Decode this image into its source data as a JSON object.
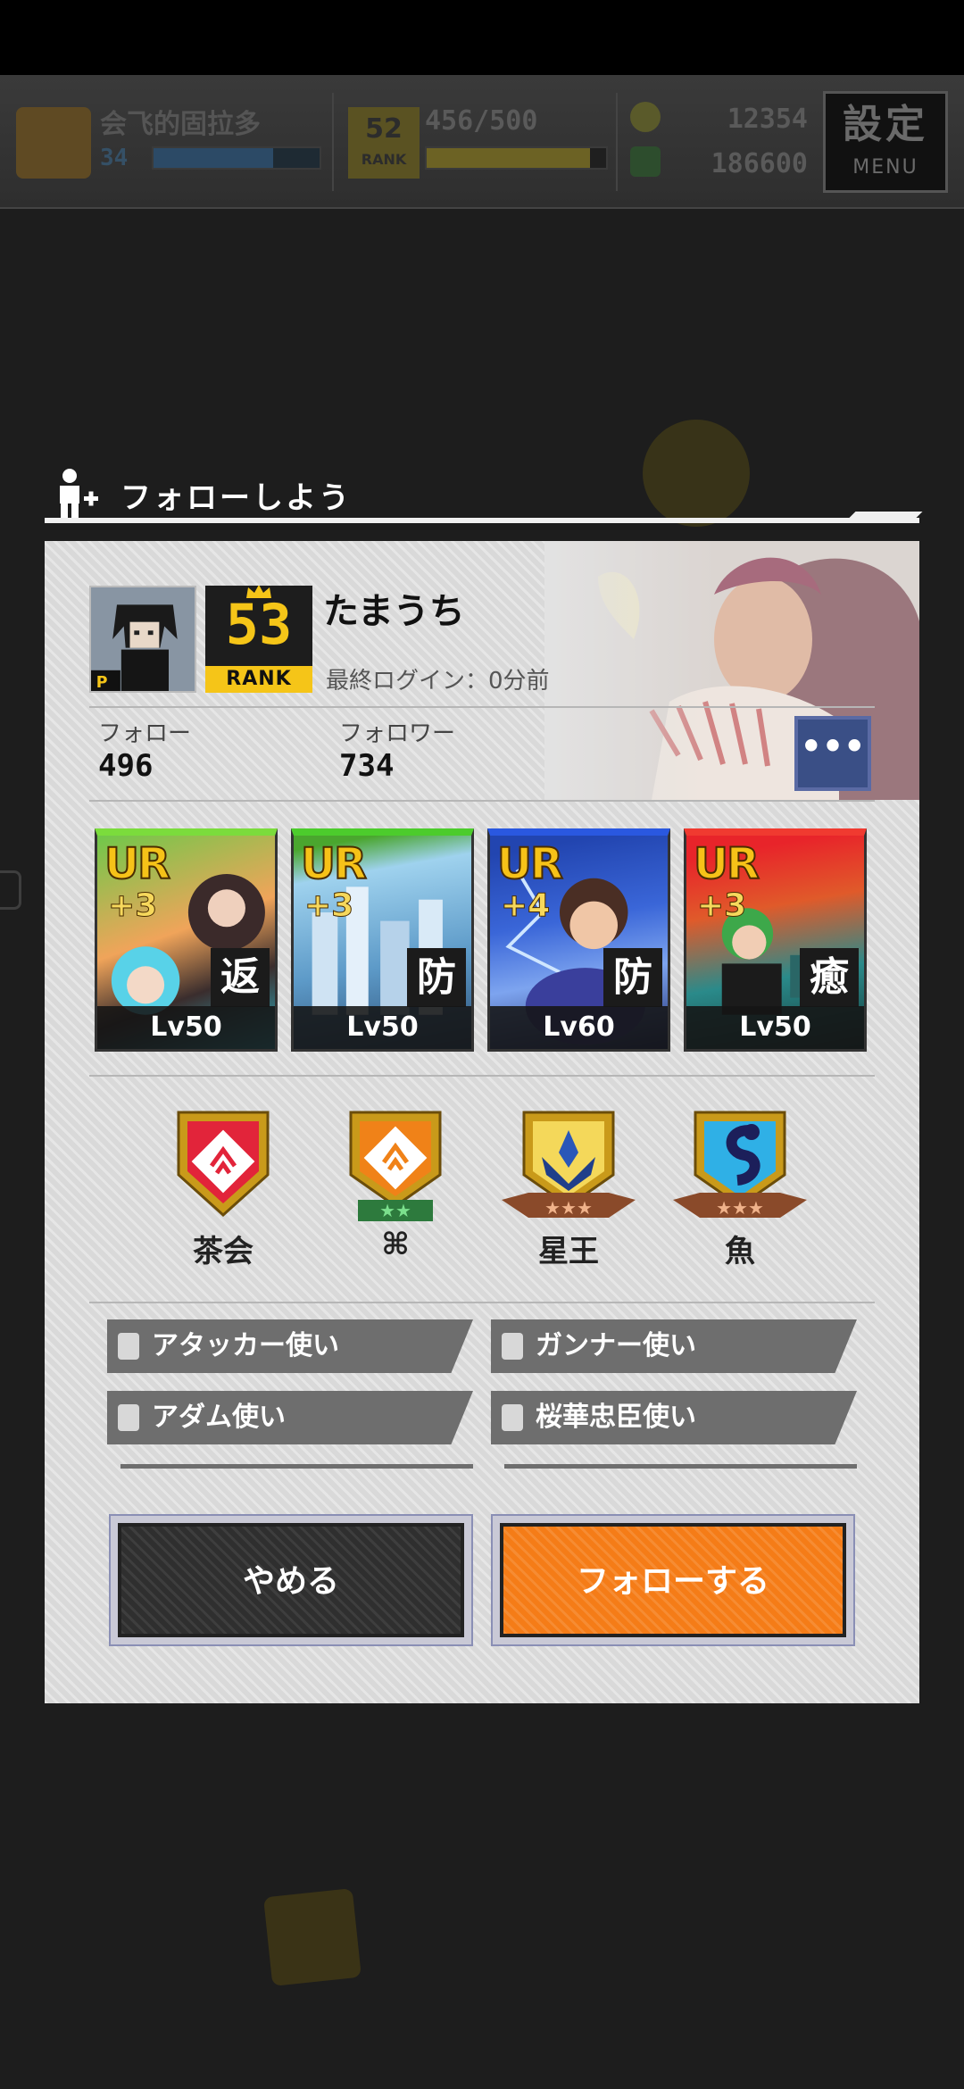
{
  "hud": {
    "player_name": "会飞的固拉多",
    "level": "34",
    "rank": "52",
    "rank_label": "RANK",
    "stamina": "456/500",
    "coins": "12354",
    "cash": "186600",
    "menu_kanji": "設定",
    "menu_label": "MENU"
  },
  "dialog": {
    "title": "フォローしよう",
    "player": {
      "name": "たまうち",
      "rank": "53",
      "rank_label": "RANK",
      "last_login": "最終ログイン：0分前"
    },
    "stats": {
      "follow_label": "フォロー",
      "follow_value": "496",
      "follower_label": "フォロワー",
      "follower_value": "734"
    },
    "more_button": "•••",
    "cards": [
      {
        "rarity": "UR",
        "plus": "+3",
        "role": "返",
        "level": "Lv50"
      },
      {
        "rarity": "UR",
        "plus": "+3",
        "role": "防",
        "level": "Lv50"
      },
      {
        "rarity": "UR",
        "plus": "+4",
        "role": "防",
        "level": "Lv60"
      },
      {
        "rarity": "UR",
        "plus": "+3",
        "role": "癒",
        "level": "Lv50"
      }
    ],
    "emblems": [
      {
        "name": "茶会",
        "stars": ""
      },
      {
        "name": "⌘",
        "stars": "★★"
      },
      {
        "name": "星王",
        "stars": "★★★"
      },
      {
        "name": "魚",
        "stars": "★★★"
      }
    ],
    "titles": [
      "アタッカー使い",
      "ガンナー使い",
      "アダム使い",
      "桜華忠臣使い"
    ],
    "buttons": {
      "cancel": "やめる",
      "follow": "フォローする"
    }
  },
  "colors": {
    "accent_orange": "#f57c17",
    "rank_gold": "#f5c518",
    "panel_bg": "#d9d9d9",
    "dark_button": "#2f2f2f"
  }
}
